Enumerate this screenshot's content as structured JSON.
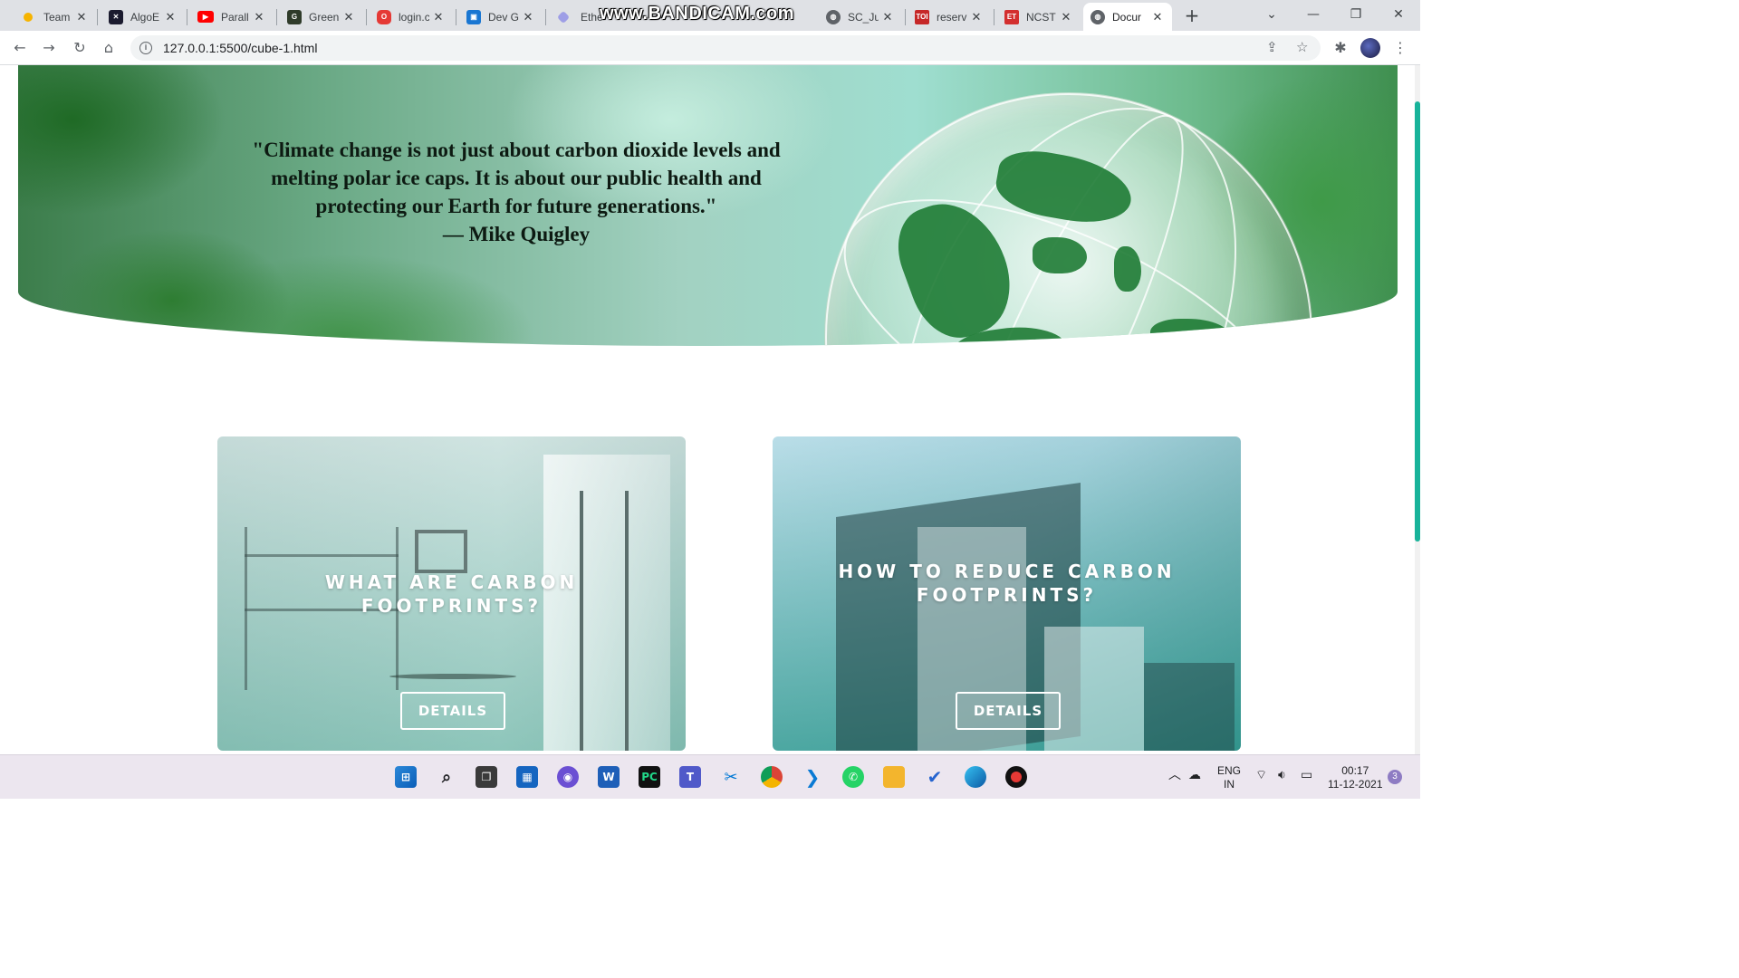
{
  "browser": {
    "tabs": [
      {
        "title": "Team",
        "color": "#f6b400"
      },
      {
        "title": "AlgoE",
        "color": "#1b1b2f"
      },
      {
        "title": "Parall",
        "color": "#ff0000"
      },
      {
        "title": "Green",
        "color": "#2f3b2a"
      },
      {
        "title": "login.c",
        "color": "#e53935"
      },
      {
        "title": "Dev G",
        "color": "#1976d2"
      },
      {
        "title": "Ethe",
        "color": "#9e9ee6"
      },
      {
        "title": "SC_Ju",
        "color": "#5f6368"
      },
      {
        "title": "reserv",
        "color": "#c62828"
      },
      {
        "title": "NCST",
        "color": "#d32f2f"
      },
      {
        "title": "Docur",
        "color": "#5f6368"
      }
    ],
    "active_tab_index": 10,
    "tab_close_glyph": "✕",
    "new_tab_glyph": "+",
    "watermark": "www.BANDICAM.com",
    "url": "127.0.0.1:5500/cube-1.html"
  },
  "page": {
    "quote": "\"Climate change is not just about carbon dioxide levels and melting polar ice caps. It is about our public health and protecting our Earth for future generations.\"",
    "quote_author": "— Mike Quigley",
    "cards": [
      {
        "title": "WHAT ARE CARBON FOOTPRINTS?",
        "button": "DETAILS"
      },
      {
        "title": "HOW TO REDUCE CARBON FOOTPRINTS?",
        "button": "DETAILS"
      }
    ]
  },
  "taskbar": {
    "language_line1": "ENG",
    "language_line2": "IN",
    "time": "00:17",
    "date": "11-12-2021",
    "notification_count": "3"
  },
  "colors": {
    "accent": "#18b39a",
    "tab_strip": "#dfe1e5",
    "taskbar": "#ece6ef"
  }
}
